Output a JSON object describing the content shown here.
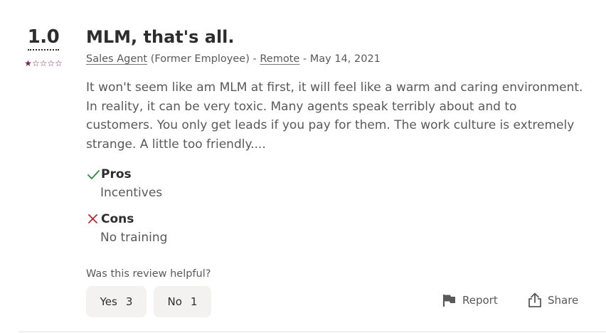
{
  "review": {
    "rating": "1.0",
    "stars": {
      "filled": 1,
      "total": 5
    },
    "title": "MLM, that's all.",
    "job_title": "Sales Agent",
    "employment_status": "(Former Employee)",
    "separator": "-",
    "location": "Remote",
    "date": "- May 14, 2021",
    "text": "It won't seem like am MLM at first, it will feel like a warm and caring environment. In reality, it can be very toxic. Many agents speak terribly about and to customers. You only get leads if you pay for them. The work culture is extremely strange. A little too friendly....",
    "pros": {
      "label": "Pros",
      "text": "Incentives"
    },
    "cons": {
      "label": "Cons",
      "text": "No training"
    }
  },
  "feedback": {
    "question": "Was this review helpful?",
    "yes_label": "Yes",
    "yes_count": "3",
    "no_label": "No",
    "no_count": "1"
  },
  "actions": {
    "report_label": "Report",
    "share_label": "Share"
  },
  "colors": {
    "star": "#7a2257",
    "pros_icon": "#2d8a3e",
    "cons_icon": "#b32d2e",
    "button_bg": "#f3f2f1"
  },
  "icons": [
    "star-icon",
    "checkmark-icon",
    "x-icon",
    "flag-icon",
    "share-icon"
  ]
}
